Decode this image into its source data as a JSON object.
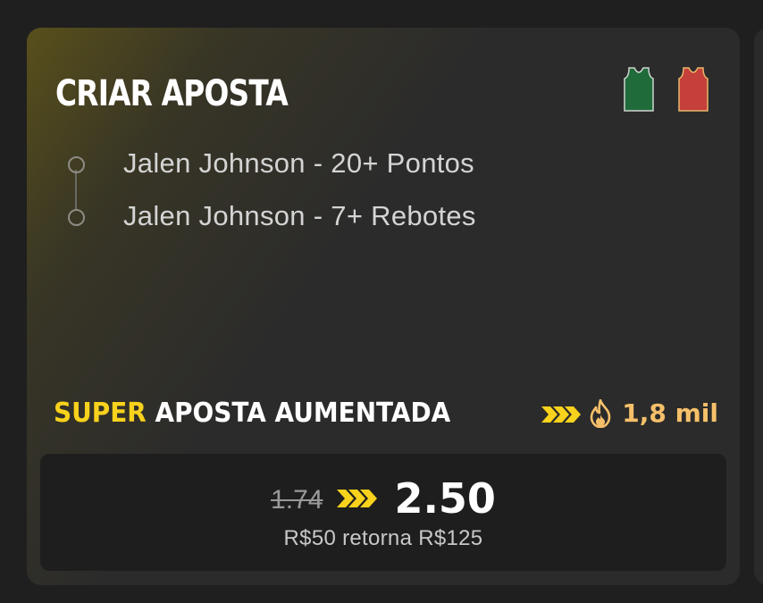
{
  "card": {
    "title": "CRIAR APOSTA",
    "team_colors": {
      "home": "#1f6b3a",
      "away": "#c5403a"
    },
    "legs": [
      {
        "label": "Jalen Johnson - 20+ Pontos"
      },
      {
        "label": "Jalen Johnson - 7+ Rebotes"
      }
    ],
    "boost": {
      "prefix": "SUPER",
      "label": "APOSTA AUMENTADA",
      "accent": "#f8d21c",
      "popularity_icon": "fire-icon",
      "popularity": "1,8 mil"
    },
    "odds": {
      "original": "1.74",
      "boosted": "2.50",
      "returns_text": "R$50 retorna R$125"
    }
  }
}
